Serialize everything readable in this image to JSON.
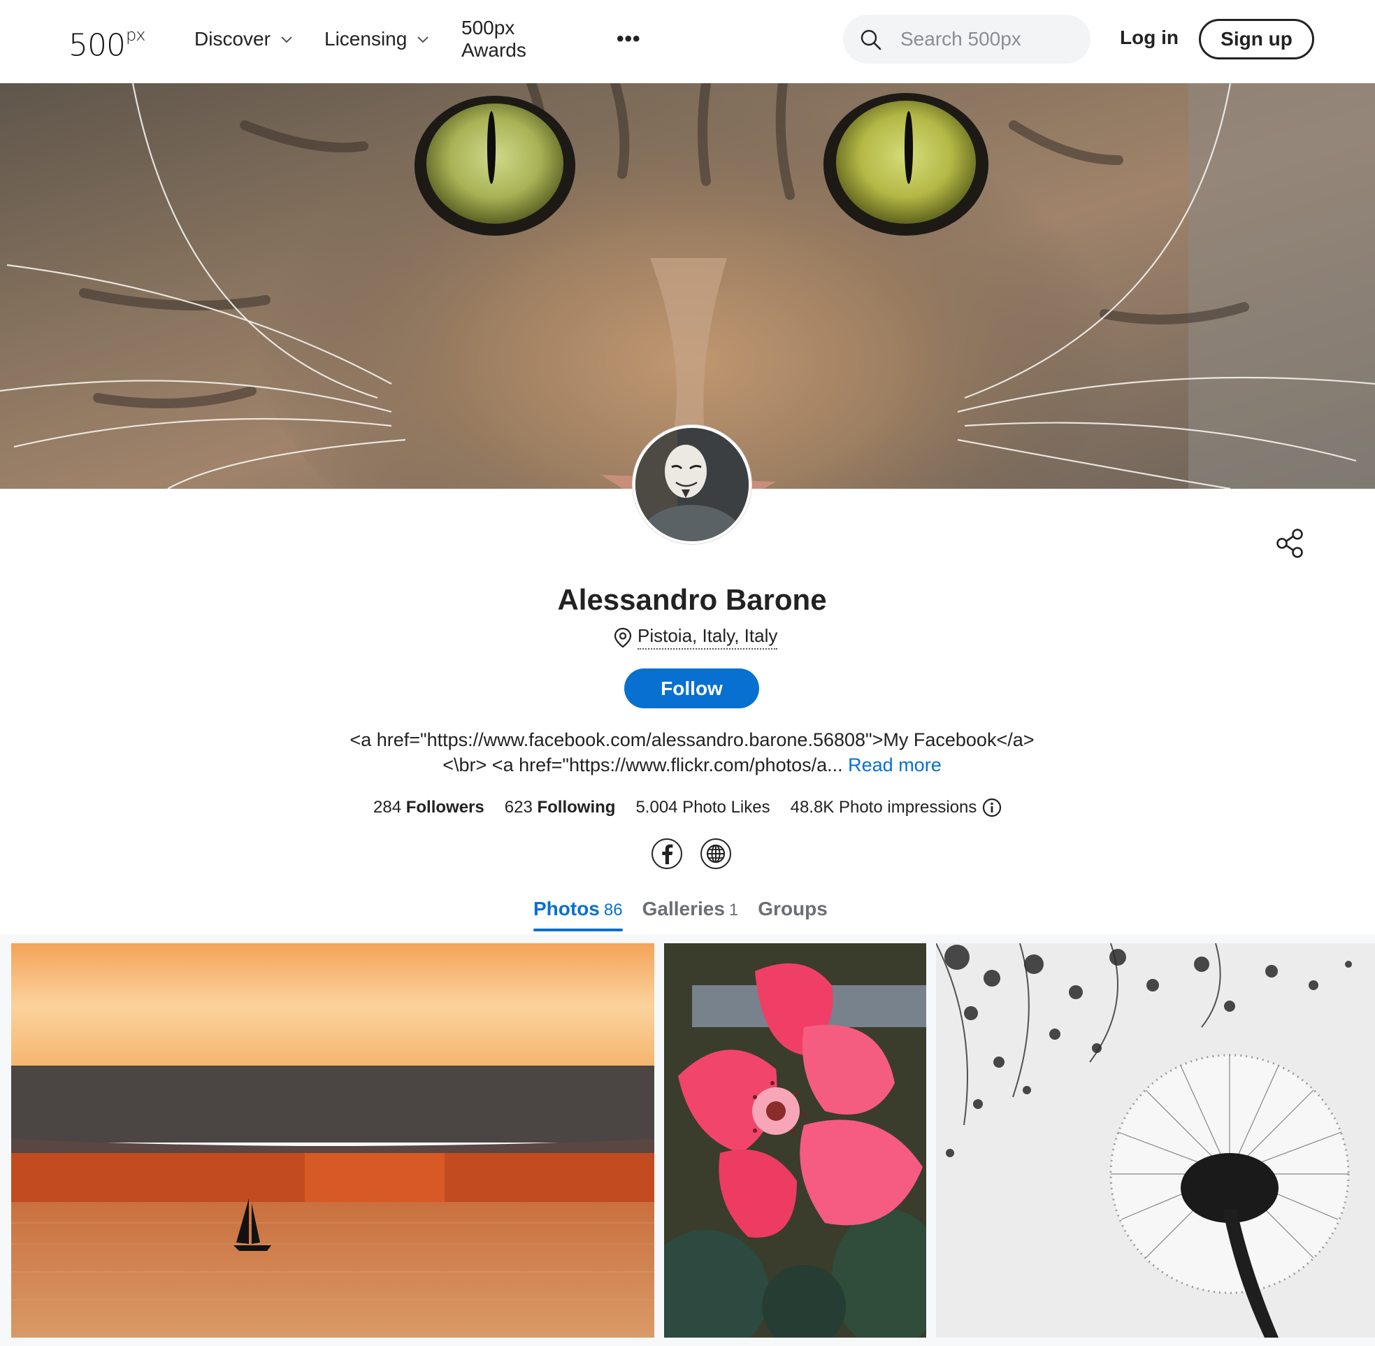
{
  "header": {
    "logo_text": "500",
    "logo_sup": "px",
    "nav": {
      "discover": "Discover",
      "licensing": "Licensing",
      "awards": "500px Awards",
      "more": "•••"
    },
    "search_placeholder": "Search 500px",
    "login": "Log in",
    "signup": "Sign up"
  },
  "profile": {
    "name": "Alessandro Barone",
    "location": "Pistoia, Italy, Italy",
    "follow_label": "Follow",
    "bio_text": "<a href=\"https://www.facebook.com/alessandro.barone.56808\">My Facebook</a><\\br> <a href=\"https://www.flickr.com/photos/a...",
    "read_more": "Read more",
    "stats": {
      "followers_count": "284",
      "followers_label": "Followers",
      "following_count": "623",
      "following_label": "Following",
      "likes": "5.004 Photo Likes",
      "impressions": "48.8K Photo impressions"
    }
  },
  "tabs": {
    "photos_label": "Photos",
    "photos_count": "86",
    "galleries_label": "Galleries",
    "galleries_count": "1",
    "groups_label": "Groups"
  },
  "icons": {
    "search": "search-icon",
    "share": "share-icon",
    "location": "location-pin-icon",
    "info": "info-icon",
    "facebook": "facebook-icon",
    "website": "globe-icon"
  },
  "colors": {
    "accent": "#0870d1",
    "text": "#222222"
  }
}
